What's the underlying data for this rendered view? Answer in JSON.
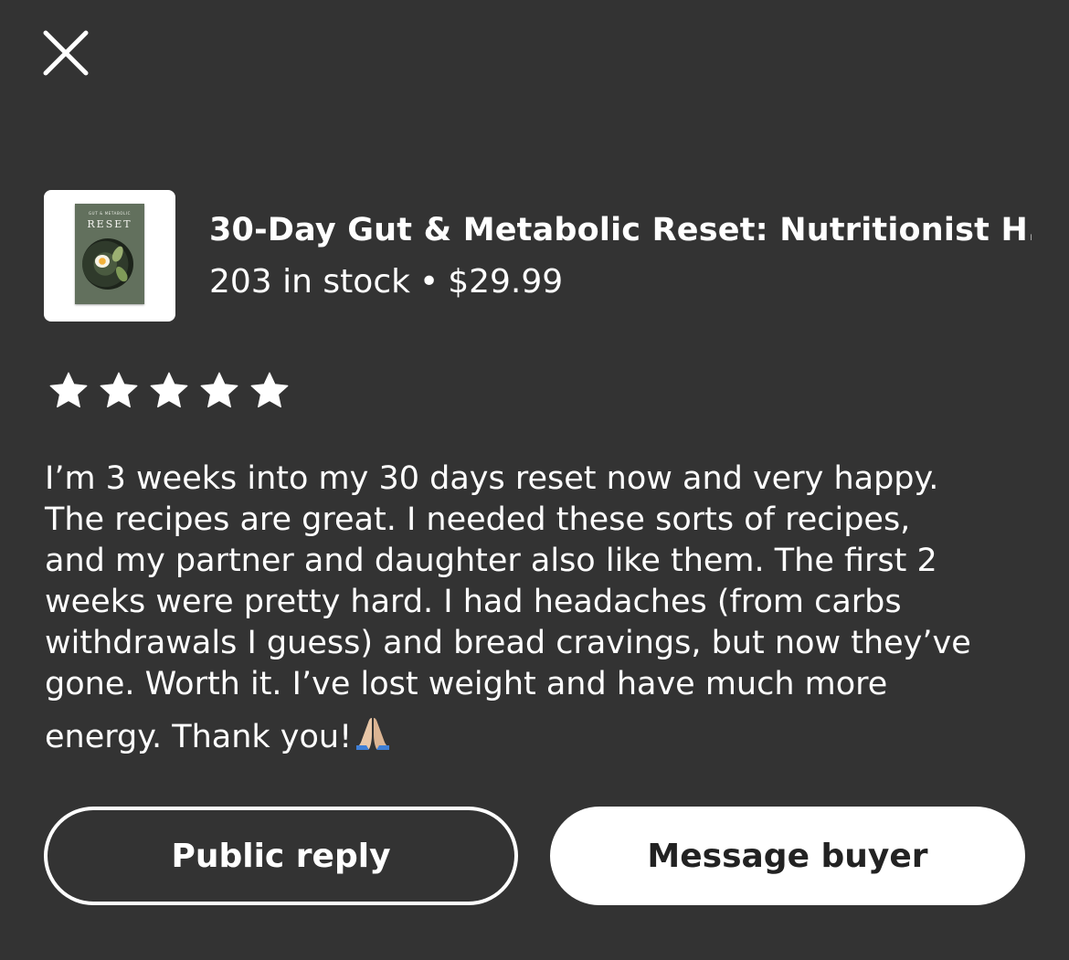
{
  "dialog": {
    "close_icon": "close-icon"
  },
  "product": {
    "thumbnail_text": "RESET",
    "thumbnail_subtext": "GUT & METABOLIC",
    "title": "30-Day Gut & Metabolic Reset: Nutritionist H...",
    "stock": "203 in stock",
    "separator": "•",
    "price": "$29.99"
  },
  "rating": {
    "stars": 5,
    "max": 5,
    "icon": "star-icon",
    "color": "#ffffff"
  },
  "review": {
    "lines": [
      "I’m 3 weeks into my 30 days reset now and very happy.",
      "The recipes are great. I needed these sorts of recipes,",
      "and my partner and daughter also like them. The first 2",
      "weeks were pretty hard. I had headaches (from carbs",
      "withdrawals I guess) and bread cravings, but now they’ve",
      "gone. Worth it. I’ve lost weight and have much more",
      "energy. Thank you!"
    ],
    "emoji": "praying-hands-icon"
  },
  "actions": {
    "public_reply_label": "Public reply",
    "message_buyer_label": "Message buyer"
  },
  "colors": {
    "background": "#333333",
    "text": "#ffffff",
    "primary_button_bg": "#ffffff",
    "primary_button_text": "#222222"
  }
}
